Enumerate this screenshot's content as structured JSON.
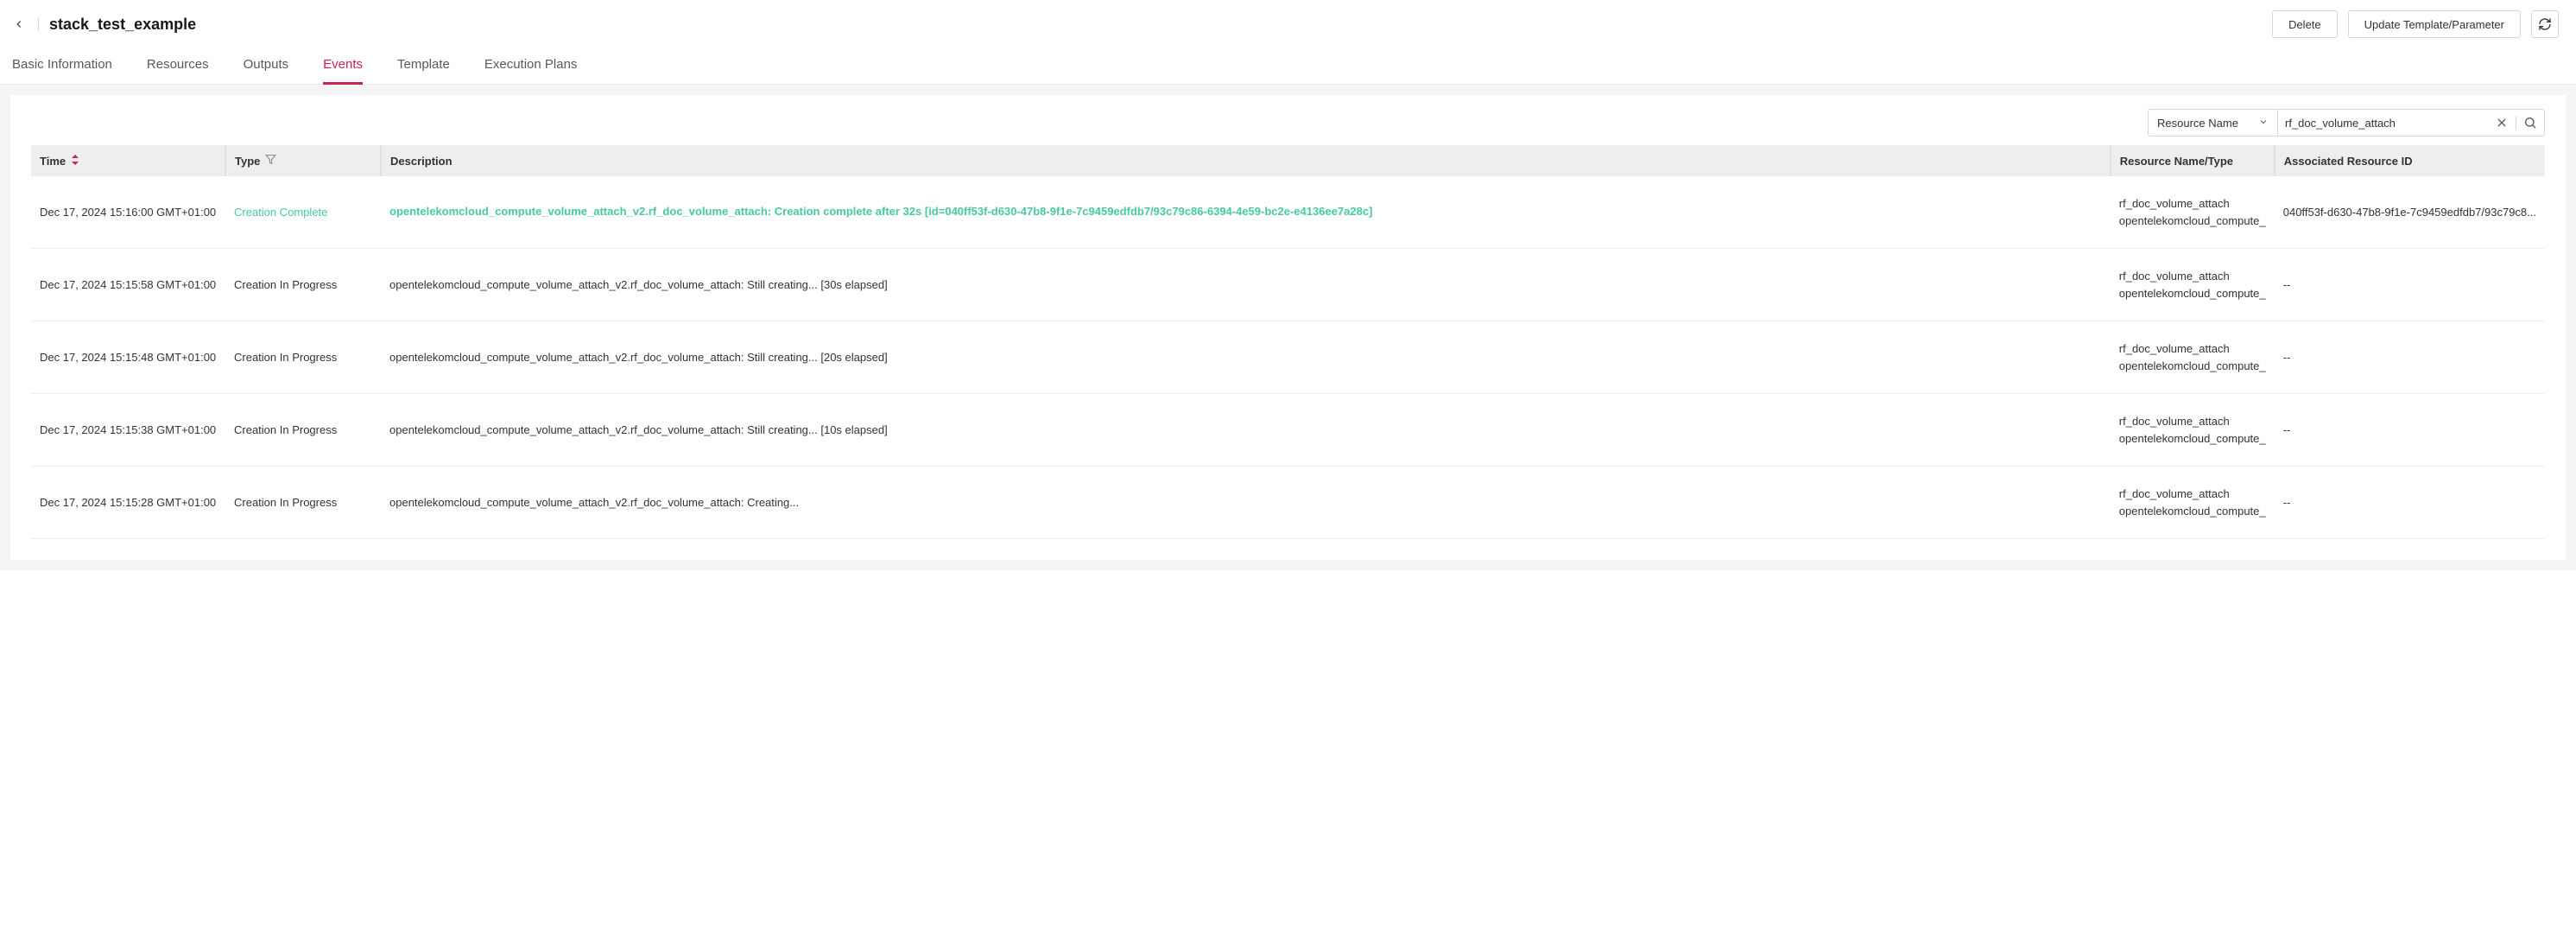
{
  "header": {
    "title": "stack_test_example",
    "delete_label": "Delete",
    "update_label": "Update Template/Parameter"
  },
  "tabs": {
    "basic": "Basic Information",
    "resources": "Resources",
    "outputs": "Outputs",
    "events": "Events",
    "template": "Template",
    "plans": "Execution Plans"
  },
  "filter": {
    "select_label": "Resource Name",
    "search_value": "rf_doc_volume_attach"
  },
  "columns": {
    "time": "Time",
    "type": "Type",
    "description": "Description",
    "resource": "Resource Name/Type",
    "associated": "Associated Resource ID"
  },
  "rows": [
    {
      "time": "Dec 17, 2024 15:16:00 GMT+01:00",
      "type": "Creation Complete",
      "type_class": "complete",
      "description": "opentelekomcloud_compute_volume_attach_v2.rf_doc_volume_attach: Creation complete after 32s [id=040ff53f-d630-47b8-9f1e-7c9459edfdb7/93c79c86-6394-4e59-bc2e-e4136ee7a28c]",
      "desc_class": "complete",
      "res_name": "rf_doc_volume_attach",
      "res_type": "opentelekomcloud_compute_v...",
      "assoc_id": "040ff53f-d630-47b8-9f1e-7c9459edfdb7/93c79c8..."
    },
    {
      "time": "Dec 17, 2024 15:15:58 GMT+01:00",
      "type": "Creation In Progress",
      "description": "opentelekomcloud_compute_volume_attach_v2.rf_doc_volume_attach: Still creating... [30s elapsed]",
      "res_name": "rf_doc_volume_attach",
      "res_type": "opentelekomcloud_compute_v...",
      "assoc_id": "--"
    },
    {
      "time": "Dec 17, 2024 15:15:48 GMT+01:00",
      "type": "Creation In Progress",
      "description": "opentelekomcloud_compute_volume_attach_v2.rf_doc_volume_attach: Still creating... [20s elapsed]",
      "res_name": "rf_doc_volume_attach",
      "res_type": "opentelekomcloud_compute_v...",
      "assoc_id": "--"
    },
    {
      "time": "Dec 17, 2024 15:15:38 GMT+01:00",
      "type": "Creation In Progress",
      "description": "opentelekomcloud_compute_volume_attach_v2.rf_doc_volume_attach: Still creating... [10s elapsed]",
      "res_name": "rf_doc_volume_attach",
      "res_type": "opentelekomcloud_compute_v...",
      "assoc_id": "--"
    },
    {
      "time": "Dec 17, 2024 15:15:28 GMT+01:00",
      "type": "Creation In Progress",
      "description": "opentelekomcloud_compute_volume_attach_v2.rf_doc_volume_attach: Creating...",
      "res_name": "rf_doc_volume_attach",
      "res_type": "opentelekomcloud_compute_v...",
      "assoc_id": "--"
    }
  ]
}
